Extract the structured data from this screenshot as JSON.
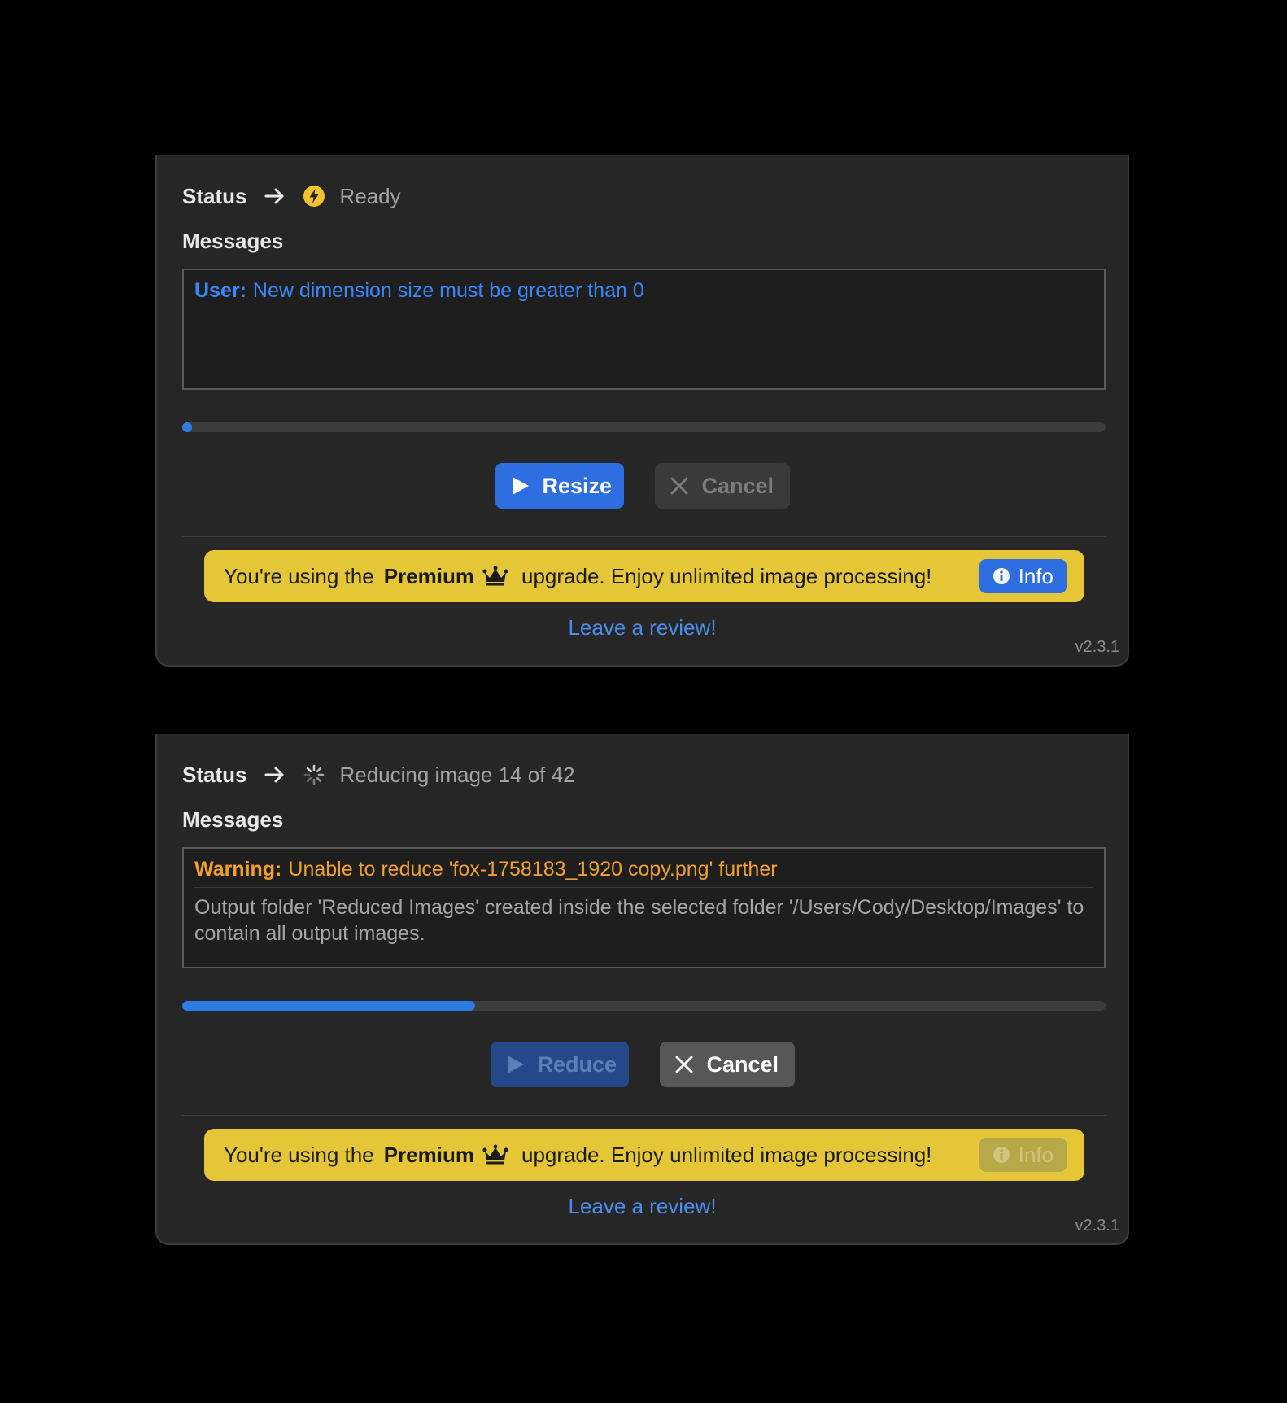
{
  "colors": {
    "background": "#000000",
    "panel": "#262626",
    "accent_blue": "#2f6ee0",
    "warning_orange": "#f0a030",
    "premium_yellow": "#e5c637"
  },
  "panels": [
    {
      "status": {
        "label": "Status",
        "arrow_icon": "arrow-right-icon",
        "state_icon": "lightning-icon",
        "state_text": "Ready"
      },
      "messages": {
        "heading": "Messages",
        "user_prefix": "User:",
        "user_text": "New dimension size must be greater than 0"
      },
      "progress": {
        "percent": 0
      },
      "buttons": {
        "primary_label": "Resize",
        "primary_icon": "play-icon",
        "primary_enabled": true,
        "cancel_label": "Cancel",
        "cancel_icon": "close-icon",
        "cancel_enabled": false
      },
      "banner": {
        "prefix": "You're using the",
        "bold": "Premium",
        "crown_icon": "crown-icon",
        "suffix": "upgrade. Enjoy unlimited image processing!",
        "info_label": "Info",
        "info_icon": "info-icon",
        "info_enabled": true
      },
      "review_link": "Leave a review!",
      "version": "v2.3.1"
    },
    {
      "status": {
        "label": "Status",
        "arrow_icon": "arrow-right-icon",
        "state_icon": "spinner-icon",
        "state_text": "Reducing image 14 of 42"
      },
      "messages": {
        "heading": "Messages",
        "warning_prefix": "Warning:",
        "warning_text": "Unable to reduce 'fox-1758183_1920 copy.png' further",
        "info_text": "Output folder 'Reduced Images' created inside the selected folder '/Users/Cody/Desktop/Images' to contain all output images."
      },
      "progress": {
        "percent": 31.7
      },
      "buttons": {
        "primary_label": "Reduce",
        "primary_icon": "play-icon",
        "primary_enabled": false,
        "cancel_label": "Cancel",
        "cancel_icon": "close-icon",
        "cancel_enabled": true
      },
      "banner": {
        "prefix": "You're using the",
        "bold": "Premium",
        "crown_icon": "crown-icon",
        "suffix": "upgrade. Enjoy unlimited image processing!",
        "info_label": "Info",
        "info_icon": "info-icon",
        "info_enabled": false
      },
      "review_link": "Leave a review!",
      "version": "v2.3.1"
    }
  ]
}
